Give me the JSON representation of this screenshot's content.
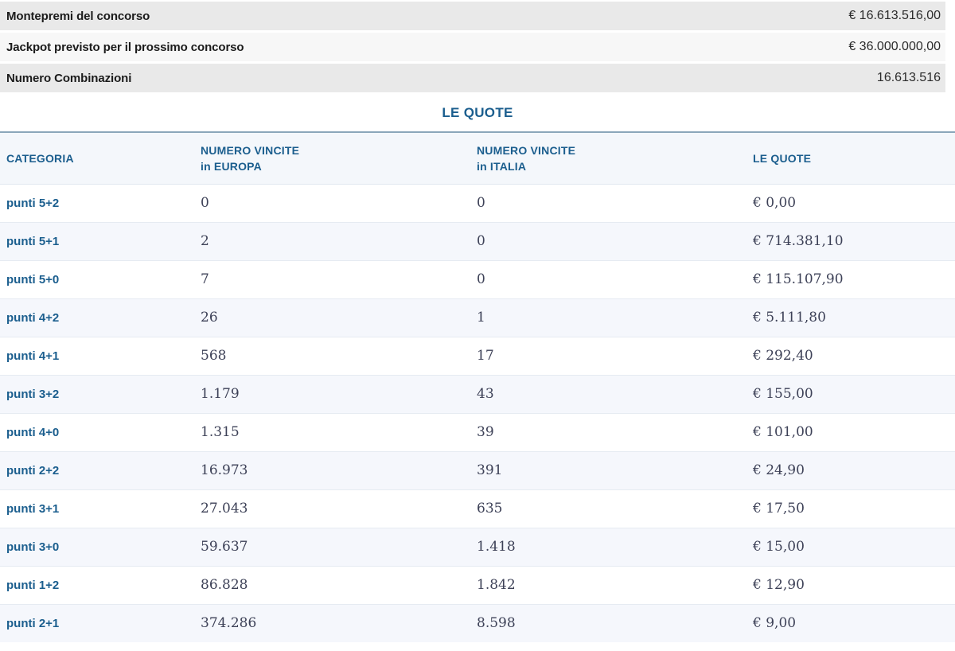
{
  "summary": {
    "rows": [
      {
        "label": "Montepremi del concorso",
        "value": "€ 16.613.516,00"
      },
      {
        "label": "Jackpot previsto per il prossimo concorso",
        "value": "€ 36.000.000,00"
      },
      {
        "label": "Numero Combinazioni",
        "value": "16.613.516"
      }
    ]
  },
  "section_title": "LE QUOTE",
  "quote_table": {
    "headers": [
      {
        "line1": "CATEGORIA",
        "line2": ""
      },
      {
        "line1": "NUMERO VINCITE",
        "line2": "in EUROPA"
      },
      {
        "line1": "NUMERO VINCITE",
        "line2": "in ITALIA"
      },
      {
        "line1": "LE QUOTE",
        "line2": ""
      }
    ],
    "rows": [
      {
        "categoria": "punti 5+2",
        "vincite_europa": "0",
        "vincite_italia": "0",
        "quota": "€ 0,00"
      },
      {
        "categoria": "punti 5+1",
        "vincite_europa": "2",
        "vincite_italia": "0",
        "quota": "€ 714.381,10"
      },
      {
        "categoria": "punti 5+0",
        "vincite_europa": "7",
        "vincite_italia": "0",
        "quota": "€ 115.107,90"
      },
      {
        "categoria": "punti 4+2",
        "vincite_europa": "26",
        "vincite_italia": "1",
        "quota": "€ 5.111,80"
      },
      {
        "categoria": "punti 4+1",
        "vincite_europa": "568",
        "vincite_italia": "17",
        "quota": "€ 292,40"
      },
      {
        "categoria": "punti 3+2",
        "vincite_europa": "1.179",
        "vincite_italia": "43",
        "quota": "€ 155,00"
      },
      {
        "categoria": "punti 4+0",
        "vincite_europa": "1.315",
        "vincite_italia": "39",
        "quota": "€ 101,00"
      },
      {
        "categoria": "punti 2+2",
        "vincite_europa": "16.973",
        "vincite_italia": "391",
        "quota": "€ 24,90"
      },
      {
        "categoria": "punti 3+1",
        "vincite_europa": "27.043",
        "vincite_italia": "635",
        "quota": "€ 17,50"
      },
      {
        "categoria": "punti 3+0",
        "vincite_europa": "59.637",
        "vincite_italia": "1.418",
        "quota": "€ 15,00"
      },
      {
        "categoria": "punti 1+2",
        "vincite_europa": "86.828",
        "vincite_italia": "1.842",
        "quota": "€ 12,90"
      },
      {
        "categoria": "punti 2+1",
        "vincite_europa": "374.286",
        "vincite_italia": "8.598",
        "quota": "€ 9,00"
      }
    ]
  },
  "colors": {
    "accent_blue": "#1b5e8e",
    "summary_row_bg": "#e9e9e9",
    "summary_row_alt_bg": "#f7f7f7",
    "table_header_bg": "#f4f7fb",
    "row_alt_bg": "#f5f7fc",
    "divider": "#8ba6ba",
    "number_text": "#3d4157"
  }
}
